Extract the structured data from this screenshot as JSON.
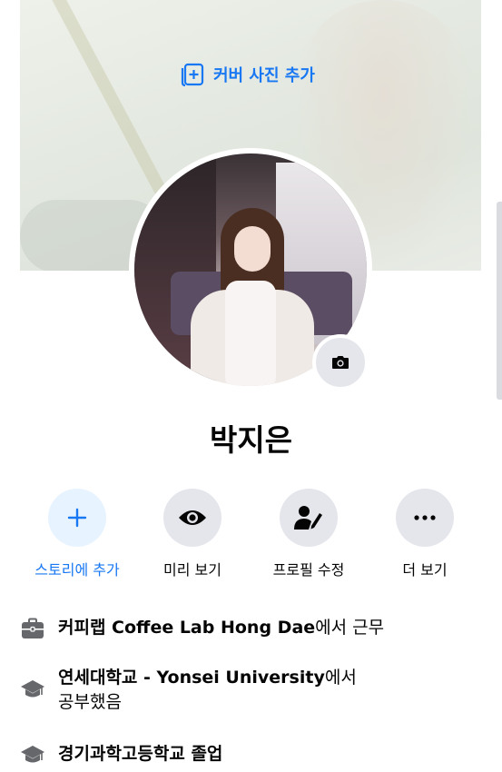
{
  "cover": {
    "add_label": "커버 사진 추가",
    "accent": "#1877f2"
  },
  "profile": {
    "name": "박지은",
    "camera_icon": "camera-icon"
  },
  "actions": [
    {
      "label": "스토리에 추가",
      "icon": "plus-icon",
      "highlight": true
    },
    {
      "label": "미리 보기",
      "icon": "eye-icon",
      "highlight": false
    },
    {
      "label": "프로필 수정",
      "icon": "edit-profile-icon",
      "highlight": false
    },
    {
      "label": "더 보기",
      "icon": "more-icon",
      "highlight": false
    }
  ],
  "info": {
    "work": {
      "place": "커피랩 Coffee Lab Hong Dae",
      "suffix": "에서 근무",
      "icon": "briefcase-icon"
    },
    "university": {
      "place": "연세대학교 - Yonsei University",
      "suffix": "에서",
      "line2": "공부했음",
      "icon": "graduation-cap-icon"
    },
    "highschool": {
      "text": "경기과학고등학교 졸업",
      "icon": "graduation-cap-icon"
    }
  },
  "colors": {
    "accent": "#1877f2",
    "button_bg": "#e4e6eb",
    "story_bg": "#e7f3ff",
    "icon_gray": "#65676b"
  }
}
